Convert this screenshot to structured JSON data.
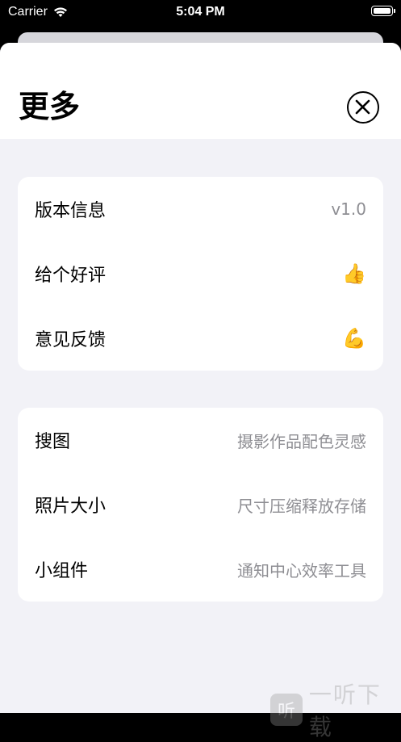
{
  "status_bar": {
    "carrier": "Carrier",
    "time": "5:04 PM"
  },
  "sheet": {
    "title": "更多"
  },
  "about_card": {
    "rows": [
      {
        "label": "版本信息",
        "value": "v1.0"
      },
      {
        "label": "给个好评",
        "icon": "👍"
      },
      {
        "label": "意见反馈",
        "icon": "💪"
      }
    ]
  },
  "apps_card": {
    "rows": [
      {
        "label": "搜图",
        "value": "摄影作品配色灵感"
      },
      {
        "label": "照片大小",
        "value": "尺寸压缩释放存储"
      },
      {
        "label": "小组件",
        "value": "通知中心效率工具"
      }
    ]
  },
  "watermark": {
    "glyph": "听",
    "text": "一听下载"
  },
  "colors": {
    "background": "#f2f2f7",
    "secondary_text": "#8e8e93",
    "card": "#ffffff"
  }
}
